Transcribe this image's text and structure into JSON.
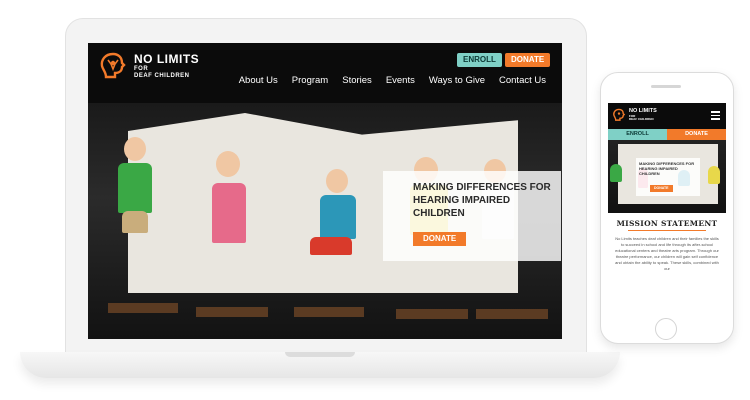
{
  "desktop": {
    "logo": {
      "line1": "NO LIMITS",
      "line2": "FOR",
      "line3": "DEAF CHILDREN"
    },
    "header_buttons": {
      "enroll": "ENROLL",
      "donate": "DONATE"
    },
    "nav": [
      "About Us",
      "Program",
      "Stories",
      "Events",
      "Ways to Give",
      "Contact Us"
    ],
    "hero": {
      "title": "MAKING DIFFERENCES FOR HEARING IMPAIRED CHILDREN",
      "button": "DONATE"
    }
  },
  "mobile": {
    "logo": {
      "line1": "NO LIMITS",
      "line2": "FOR",
      "line3": "DEAF CHILDREN"
    },
    "enroll": "ENROLL",
    "donate": "DONATE",
    "hero": {
      "title": "MAKING DIFFERENCES FOR HEARING IMPAIRED CHILDREN",
      "button": "DONATE"
    },
    "mission_heading": "MISSION STATEMENT",
    "mission_text": "No Limits teaches deaf children and their families the skills to succeed in school and life through its after-school educational centers and theatre arts program. Through our theatre performance, our children will gain self confidence and obtain the ability to speak. These skills, combined with our"
  },
  "colors": {
    "accent_orange": "#f27a2a",
    "accent_teal": "#7fd0c6",
    "header_bg": "#0b0b0b"
  }
}
